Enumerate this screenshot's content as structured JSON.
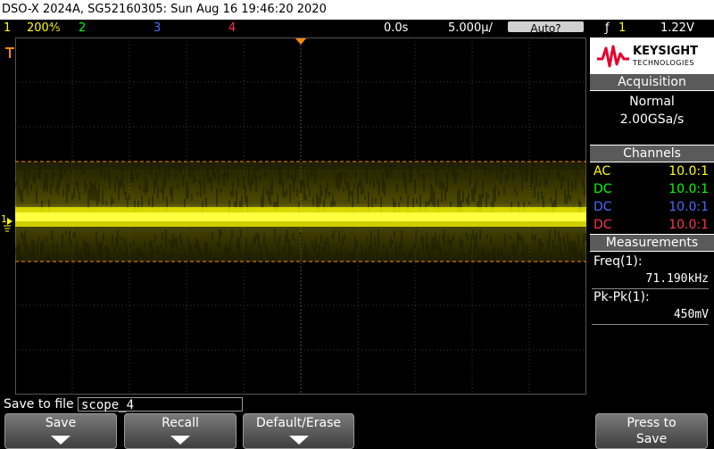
{
  "title": "DSO-X 2024A, SG52160305: Sun Aug 16 19:46:20 2020",
  "status": {
    "ch1_num": "1",
    "ch1_scale": "200⅘",
    "ch2_num": "2",
    "ch3_num": "3",
    "ch4_num": "4",
    "time_delay": "0.0s",
    "time_scale": "5.000µ/",
    "trigger_mode": "Auto?",
    "trigger_icon": "ƒ",
    "trigger_channel": "1",
    "trigger_level": "1.22V"
  },
  "logo": {
    "brand": "KEYSIGHT",
    "sub": "TECHNOLOGIES"
  },
  "acquisition": {
    "header": "Acquisition",
    "mode": "Normal",
    "rate": "2.00GSa/s"
  },
  "channels": {
    "header": "Channels",
    "rows": [
      {
        "coupling": "AC",
        "probe": "10.0:1",
        "color": "#ffff00"
      },
      {
        "coupling": "DC",
        "probe": "10.0:1",
        "color": "#00ff00"
      },
      {
        "coupling": "DC",
        "probe": "10.0:1",
        "color": "#4a6cff"
      },
      {
        "coupling": "DC",
        "probe": "10.0:1",
        "color": "#ff3355"
      }
    ]
  },
  "measurements": {
    "header": "Measurements",
    "items": [
      {
        "label": "Freq(1):",
        "value": "71.190kHz"
      },
      {
        "label": "Pk-Pk(1):",
        "value": "450mV"
      }
    ]
  },
  "save": {
    "label": "Save to file =",
    "filename": "scope_4"
  },
  "softkeys": {
    "save": "Save",
    "recall": "Recall",
    "default": "Default/Erase",
    "press1": "Press to",
    "press2": "Save"
  },
  "marker": {
    "ch1_label": "1"
  },
  "colors": {
    "ch1": "#ffff00",
    "ch2": "#00ff00",
    "ch3": "#4a6cff",
    "ch4": "#ff3355",
    "trigger": "#ff8c00"
  }
}
